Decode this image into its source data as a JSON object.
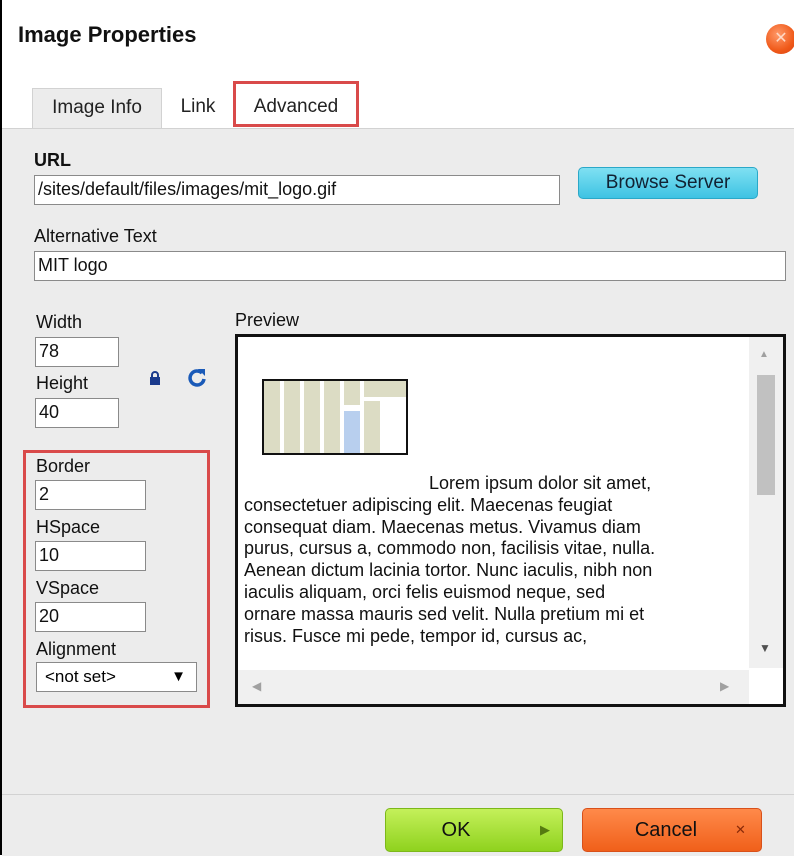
{
  "dialog": {
    "title": "Image Properties",
    "close_icon": "close-icon"
  },
  "tabs": [
    {
      "label": "Image Info",
      "active": true
    },
    {
      "label": "Link",
      "active": false
    },
    {
      "label": "Advanced",
      "active": false,
      "highlighted": true
    }
  ],
  "image_info": {
    "url_label": "URL",
    "url_value": "/sites/default/files/images/mit_logo.gif",
    "browse_label": "Browse Server",
    "alt_label": "Alternative Text",
    "alt_value": "MIT logo",
    "width_label": "Width",
    "width_value": "78",
    "height_label": "Height",
    "height_value": "40",
    "lock_icon": "lock-icon",
    "reset_icon": "reset-size-icon",
    "border_label": "Border",
    "border_value": "2",
    "hspace_label": "HSpace",
    "hspace_value": "10",
    "vspace_label": "VSpace",
    "vspace_value": "20",
    "alignment_label": "Alignment",
    "alignment_value": "<not set>",
    "preview_label": "Preview",
    "preview_lines": [
      "Lorem ipsum dolor sit amet,",
      "consectetuer adipiscing elit. Maecenas feugiat",
      "consequat diam. Maecenas metus. Vivamus diam",
      "purus, cursus a, commodo non, facilisis vitae, nulla.",
      "Aenean dictum lacinia tortor. Nunc iaculis, nibh non",
      "iaculis aliquam, orci felis euismod neque, sed",
      "ornare massa mauris sed velit. Nulla pretium mi et",
      "risus. Fusce mi pede, tempor id, cursus ac,"
    ]
  },
  "footer": {
    "ok_label": "OK",
    "cancel_label": "Cancel"
  },
  "colors": {
    "highlight": "#d94a4a",
    "browse": "#3ec3e3",
    "ok": "#8fd21e",
    "cancel": "#f0601a"
  }
}
